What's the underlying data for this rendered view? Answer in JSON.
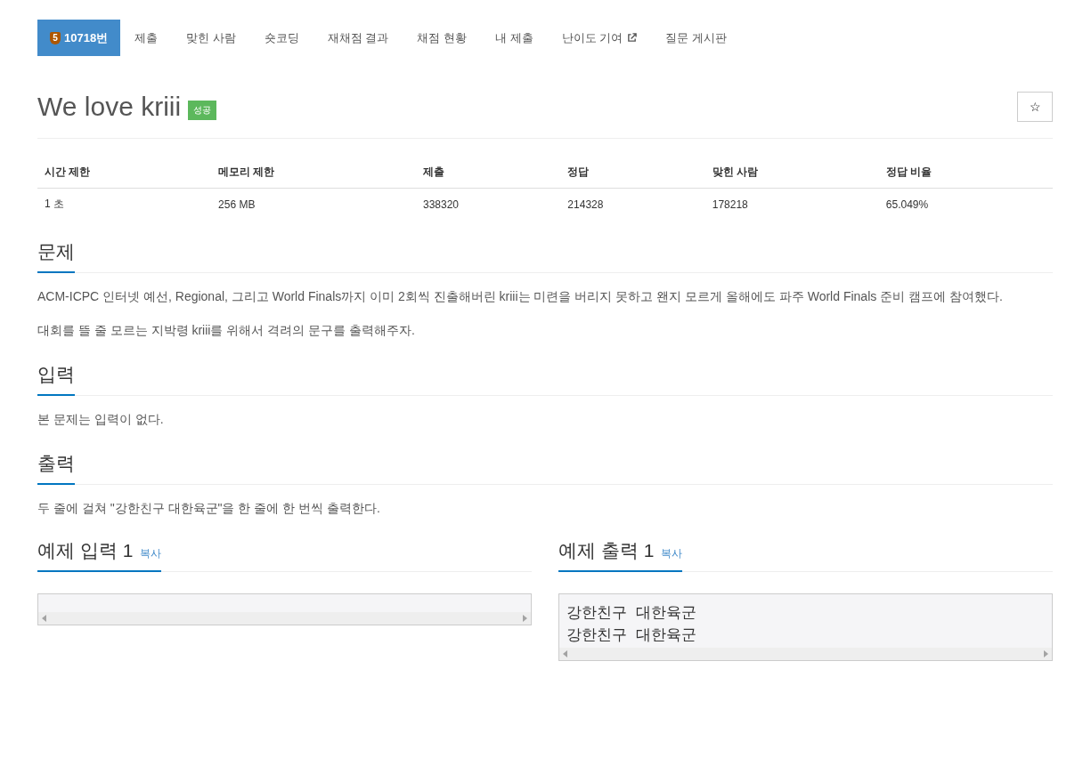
{
  "tabs": [
    {
      "label": "10718번",
      "selected": true,
      "level_badge": "5"
    },
    {
      "label": "제출",
      "selected": false
    },
    {
      "label": "맞힌 사람",
      "selected": false
    },
    {
      "label": "숏코딩",
      "selected": false
    },
    {
      "label": "재채점 결과",
      "selected": false
    },
    {
      "label": "채점 현황",
      "selected": false
    },
    {
      "label": "내 제출",
      "selected": false
    },
    {
      "label": "난이도 기여",
      "selected": false,
      "external": true
    },
    {
      "label": "질문 게시판",
      "selected": false
    }
  ],
  "problem": {
    "title": "We love kriii",
    "status_label": "성공",
    "favorite_icon": "☆"
  },
  "stats": {
    "columns": [
      "시간 제한",
      "메모리 제한",
      "제출",
      "정답",
      "맞힌 사람",
      "정답 비율"
    ],
    "row": [
      "1 초",
      "256 MB",
      "338320",
      "214328",
      "178218",
      "65.049%"
    ]
  },
  "sections": [
    {
      "heading": "문제",
      "paragraphs": [
        "ACM-ICPC 인터넷 예선, Regional, 그리고 World Finals까지 이미 2회씩 진출해버린 kriii는 미련을 버리지 못하고 왠지 모르게 올해에도 파주 World Finals 준비 캠프에 참여했다.",
        "대회를 뜰 줄 모르는 지박령 kriii를 위해서 격려의 문구를 출력해주자."
      ]
    },
    {
      "heading": "입력",
      "paragraphs": [
        "본 문제는 입력이 없다."
      ]
    },
    {
      "heading": "출력",
      "paragraphs": [
        "두 줄에 걸쳐 \"강한친구 대한육군\"을 한 줄에 한 번씩 출력한다."
      ]
    }
  ],
  "samples": [
    {
      "heading": "예제 입력 1",
      "copy": "복사"
    },
    {
      "heading": "예제 출력 1",
      "copy": "복사",
      "lines": [
        "강한친구 대한육군",
        "강한친구 대한육군"
      ]
    }
  ]
}
